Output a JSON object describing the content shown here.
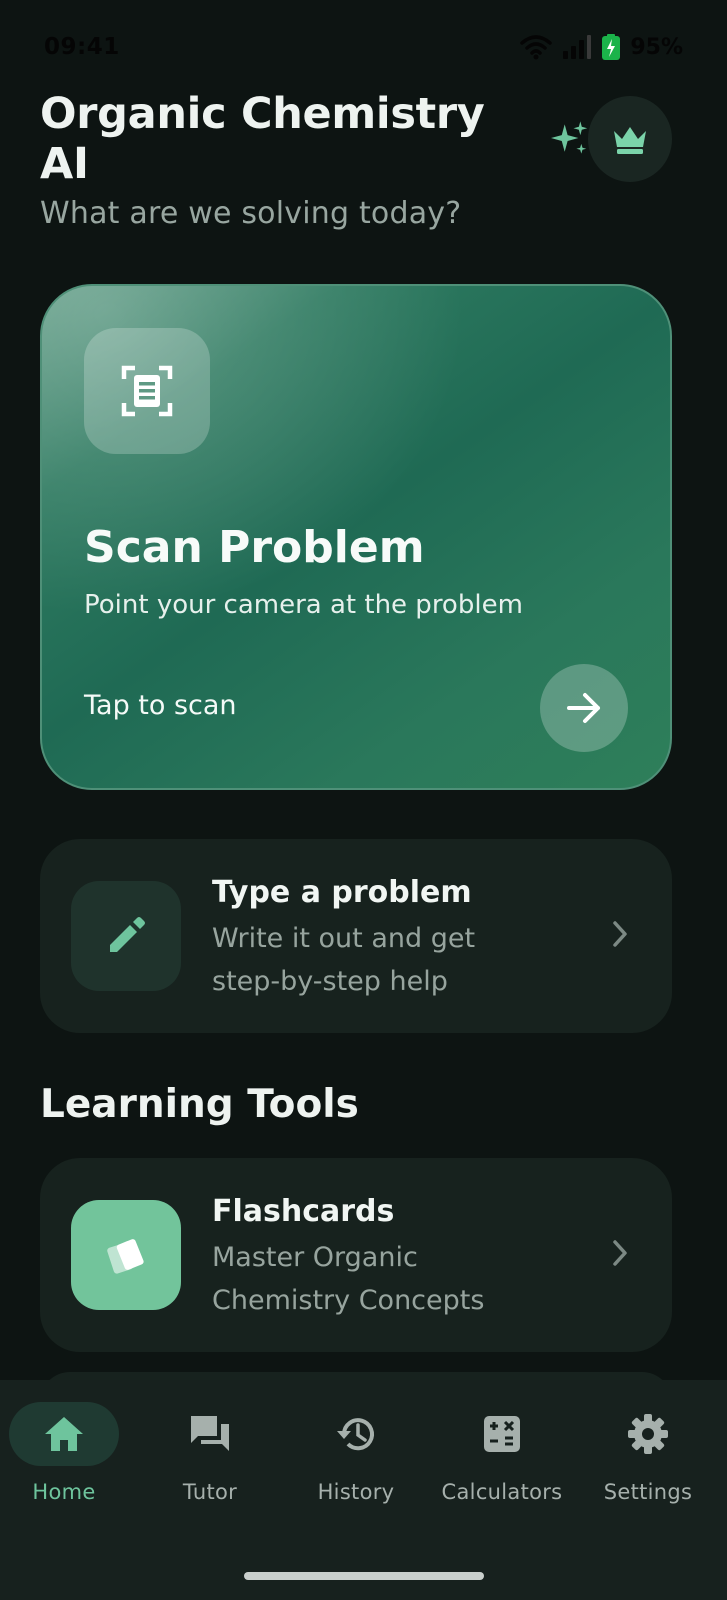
{
  "status": {
    "time": "09:41",
    "battery": "95%"
  },
  "header": {
    "title": "Organic Chemistry AI",
    "subtitle": "What are we solving today?"
  },
  "scan_card": {
    "title": "Scan Problem",
    "subtitle": "Point your camera at the problem",
    "cta": "Tap to scan"
  },
  "type_card": {
    "title": "Type a problem",
    "description_line1": "Write it out and get",
    "description_line2": "step-by-step help"
  },
  "learning_tools": {
    "heading": "Learning Tools",
    "items": [
      {
        "title": "Flashcards",
        "description_line1": "Master Organic",
        "description_line2": "Chemistry Concepts"
      }
    ]
  },
  "nav": {
    "items": [
      {
        "label": "Home",
        "icon": "home-icon",
        "active": true
      },
      {
        "label": "Tutor",
        "icon": "chat-icon",
        "active": false
      },
      {
        "label": "History",
        "icon": "history-icon",
        "active": false
      },
      {
        "label": "Calculators",
        "icon": "calculator-icon",
        "active": false
      },
      {
        "label": "Settings",
        "icon": "gear-icon",
        "active": false
      }
    ]
  },
  "colors": {
    "background": "#0d1412",
    "accent": "#6ec49d",
    "card": "#17221e",
    "scan_card": "#1f6a54"
  }
}
